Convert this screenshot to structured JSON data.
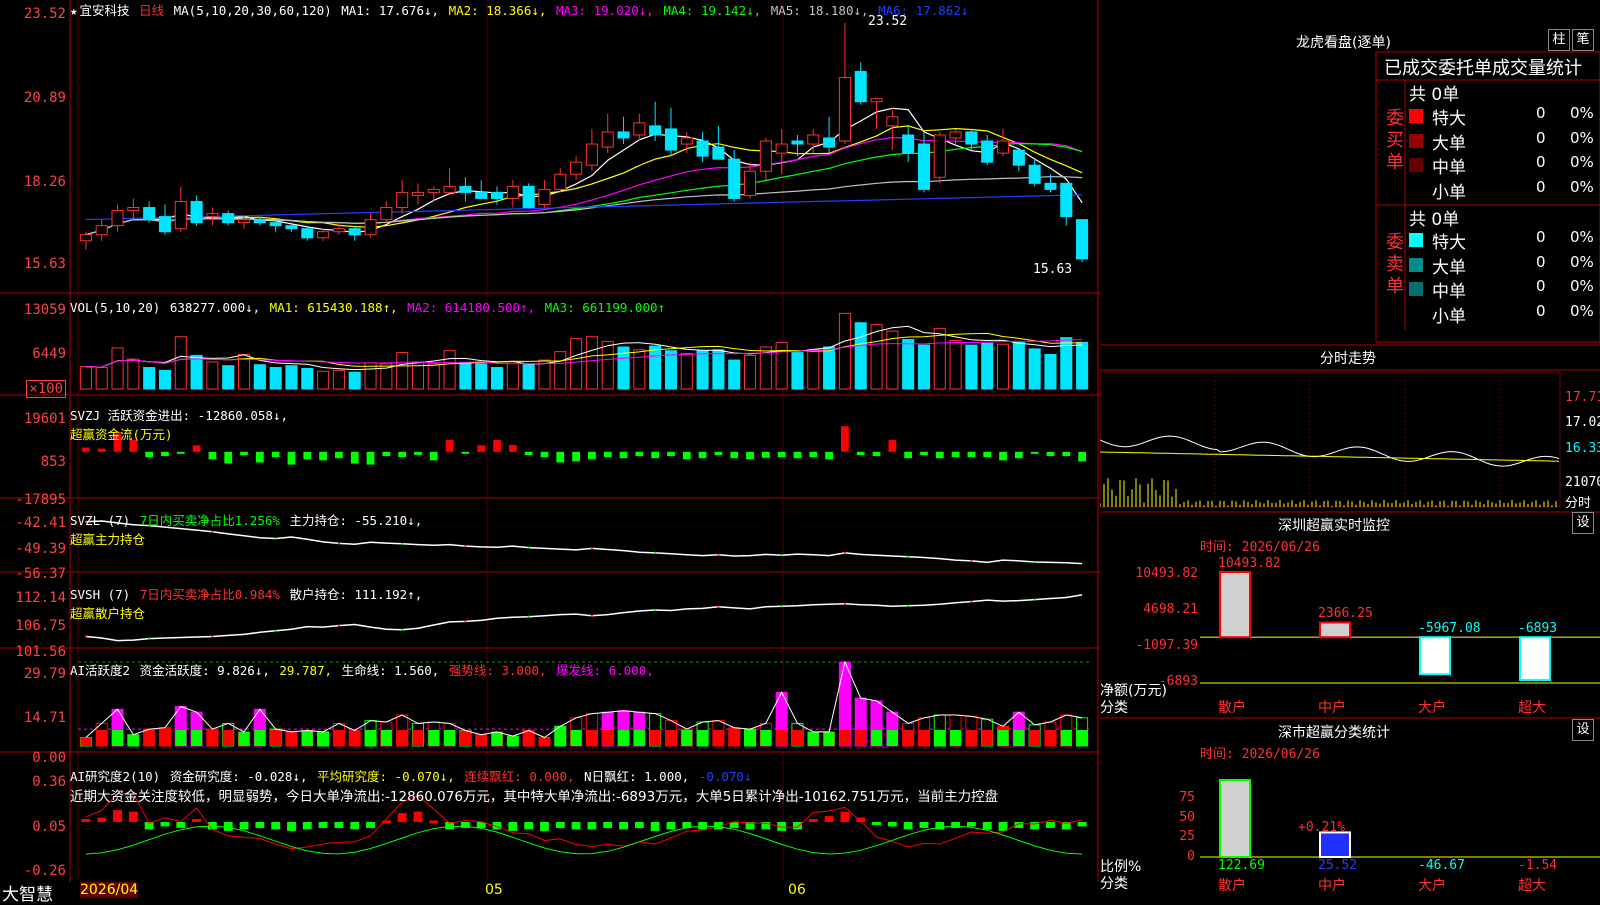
{
  "stock": {
    "name": "宜安科技",
    "period": "日线",
    "ma_label": "MA(5,10,20,30,60,120)",
    "ma1": "MA1: 17.676↓,",
    "ma2": "MA2: 18.366↓,",
    "ma3": "MA3: 19.020↓,",
    "ma4": "MA4: 19.142↓,",
    "ma5": "MA5: 18.180↓,",
    "ma6": "MA6: 17.862↓",
    "high_mark": "23.52",
    "low_mark": "15.63",
    "colors": {
      "ma1": "#ffffff",
      "ma2": "#ffff00",
      "ma3": "#ff00ff",
      "ma4": "#00ff00",
      "ma5": "#c0c0c0",
      "ma6": "#2040ff",
      "up": "#ff3030",
      "down": "#00e5ff"
    }
  },
  "axes": {
    "price": [
      "23.52",
      "20.89",
      "18.26",
      "15.63"
    ],
    "vol": [
      "13059",
      "6449",
      "×100"
    ],
    "svzj": [
      "19601",
      "853",
      "-17895"
    ],
    "svzl": [
      "-42.41",
      "-49.39",
      "-56.37"
    ],
    "svsh": [
      "112.14",
      "106.75",
      "101.56"
    ],
    "ai1": [
      "29.79",
      "14.71",
      "0.00"
    ],
    "ai2": [
      "0.36",
      "0.05",
      "-0.26"
    ]
  },
  "legends": {
    "vol": {
      "a": "VOL(5,10,20)",
      "b": " 638277.000↓,",
      "c": " MA1: 615430.188↑,",
      "d": " MA2: 614180.500↑,",
      "e": " MA3: 661199.000↑"
    },
    "svzj": {
      "a": "SVZJ  活跃资金进出: -12860.058↓,",
      "b": "超赢资金流(万元)"
    },
    "svzl": {
      "a": "SVZL (7) ",
      "b": "7日内买卖净占比1.256%",
      "c": " 主力持仓: -55.210↓,",
      "d": "超赢主力持仓"
    },
    "svsh": {
      "a": "SVSH (7) ",
      "b": "7日内买卖净占比0.984%",
      "c": " 散户持仓: 111.192↑,",
      "d": "超赢散户持仓"
    },
    "ai1": {
      "a": "AI活跃度2 ",
      "b": "资金活跃度: 9.826↓,",
      "c": " 29.787,",
      "d": " 生命线: 1.560,",
      "e": " 强势线: 3.000,",
      "f": " 爆发线: 6.000,"
    },
    "ai2": {
      "a": "AI研究度2(10) ",
      "b": "资金研究度: -0.028↓,",
      "c": " 平均研究度: -0.070↓,",
      "d": " 连续飘红: 0.000,",
      "e": " N日飘红: 1.000,",
      "f": " -0.070↓"
    },
    "ai2_text": "近期大资金关注度较低，明显弱势，今日大单净流出:-12860.076万元，其中特大单净流出:-6893万元，大单5日累计净出-10162.751万元，当前主力控盘"
  },
  "dates": {
    "d1": "2026/04",
    "d2": "05",
    "d3": "06"
  },
  "brand": "大智慧",
  "right": {
    "lhb_title": "龙虎看盘(逐单)",
    "btn1": "柱",
    "btn2": "笔",
    "header": "已成交委托单成交量统计",
    "buy_side": "委买单",
    "sell_side": "委卖单",
    "buy_total": "共 0单",
    "sell_total": "共 0单",
    "buy_rows": [
      {
        "label": "特大",
        "count": "0",
        "pct": "0%",
        "color": "#ff0000"
      },
      {
        "label": "大单",
        "count": "0",
        "pct": "0%",
        "color": "#990000"
      },
      {
        "label": "中单",
        "count": "0",
        "pct": "0%",
        "color": "#660000"
      },
      {
        "label": "小单",
        "count": "0",
        "pct": "0%",
        "color": ""
      }
    ],
    "sell_rows": [
      {
        "label": "特大",
        "count": "0",
        "pct": "0%",
        "color": "#00ffff"
      },
      {
        "label": "大单",
        "count": "0",
        "pct": "0%",
        "color": "#008b8b"
      },
      {
        "label": "中单",
        "count": "0",
        "pct": "0%",
        "color": "#007070"
      },
      {
        "label": "小单",
        "count": "0",
        "pct": "0%",
        "color": ""
      }
    ],
    "intraday_title": "分时走势",
    "intraday_axis": [
      "17.71",
      "17.02",
      "16.33",
      "21070",
      "分时"
    ],
    "monitor_title": "深圳超赢实时监控",
    "monitor_btn": "设",
    "monitor_time": "时间: 2026/06/26",
    "monitor_axis": [
      "10493.82",
      "4698.21",
      "-1097.39",
      "-6893"
    ],
    "monitor_unit": "净额(万元)",
    "monitor_cat_label": "分类",
    "monitor_values": [
      "10493.82",
      "2366.25",
      "-5967.08",
      "-6893"
    ],
    "categories": [
      "散户",
      "中户",
      "大户",
      "超大"
    ],
    "stats_title": "深市超赢分类统计",
    "stats_btn": "设",
    "stats_time": "时间: 2026/06/26",
    "stats_axis": [
      "75",
      "50",
      "25",
      "0"
    ],
    "stats_unit": "比例%",
    "stats_cat_label": "分类",
    "stats_top_label": "+0.21%",
    "stats_values": [
      "122.69",
      "25.52",
      "-46.67",
      "-1.54"
    ]
  },
  "chart_data": {
    "type": "candlestick",
    "title": "宜安科技 日线",
    "candles": [
      {
        "o": 16.3,
        "h": 16.6,
        "l": 16.0,
        "c": 16.5
      },
      {
        "o": 16.5,
        "h": 17.0,
        "l": 16.3,
        "c": 16.8
      },
      {
        "o": 16.8,
        "h": 17.5,
        "l": 16.6,
        "c": 17.3
      },
      {
        "o": 17.3,
        "h": 17.7,
        "l": 17.0,
        "c": 17.4
      },
      {
        "o": 17.4,
        "h": 17.6,
        "l": 16.9,
        "c": 17.0
      },
      {
        "o": 17.1,
        "h": 17.5,
        "l": 16.5,
        "c": 16.6
      },
      {
        "o": 16.7,
        "h": 18.1,
        "l": 16.6,
        "c": 17.6
      },
      {
        "o": 17.6,
        "h": 17.8,
        "l": 16.8,
        "c": 16.9
      },
      {
        "o": 17.1,
        "h": 17.4,
        "l": 16.8,
        "c": 17.2
      },
      {
        "o": 17.2,
        "h": 17.3,
        "l": 16.8,
        "c": 16.9
      },
      {
        "o": 16.9,
        "h": 17.1,
        "l": 16.7,
        "c": 17.0
      },
      {
        "o": 17.0,
        "h": 17.1,
        "l": 16.8,
        "c": 16.9
      },
      {
        "o": 16.9,
        "h": 17.0,
        "l": 16.6,
        "c": 16.8
      },
      {
        "o": 16.8,
        "h": 16.9,
        "l": 16.6,
        "c": 16.7
      },
      {
        "o": 16.7,
        "h": 16.8,
        "l": 16.3,
        "c": 16.4
      },
      {
        "o": 16.4,
        "h": 16.7,
        "l": 16.3,
        "c": 16.6
      },
      {
        "o": 16.6,
        "h": 16.9,
        "l": 16.5,
        "c": 16.7
      },
      {
        "o": 16.7,
        "h": 16.8,
        "l": 16.3,
        "c": 16.5
      },
      {
        "o": 16.5,
        "h": 17.2,
        "l": 16.4,
        "c": 17.0
      },
      {
        "o": 17.0,
        "h": 17.6,
        "l": 16.9,
        "c": 17.4
      },
      {
        "o": 17.4,
        "h": 18.3,
        "l": 17.2,
        "c": 17.9
      },
      {
        "o": 17.8,
        "h": 18.2,
        "l": 17.5,
        "c": 17.9
      },
      {
        "o": 17.9,
        "h": 18.1,
        "l": 17.6,
        "c": 18.0
      },
      {
        "o": 17.9,
        "h": 18.7,
        "l": 17.8,
        "c": 18.1
      },
      {
        "o": 18.1,
        "h": 18.4,
        "l": 17.6,
        "c": 17.9
      },
      {
        "o": 17.9,
        "h": 18.3,
        "l": 17.7,
        "c": 17.7
      },
      {
        "o": 17.9,
        "h": 18.1,
        "l": 17.5,
        "c": 17.7
      },
      {
        "o": 17.7,
        "h": 18.3,
        "l": 17.4,
        "c": 18.1
      },
      {
        "o": 18.1,
        "h": 18.2,
        "l": 17.4,
        "c": 17.4
      },
      {
        "o": 17.5,
        "h": 18.3,
        "l": 17.4,
        "c": 18.0
      },
      {
        "o": 18.0,
        "h": 18.7,
        "l": 17.9,
        "c": 18.5
      },
      {
        "o": 18.5,
        "h": 19.1,
        "l": 18.3,
        "c": 18.9
      },
      {
        "o": 18.8,
        "h": 20.0,
        "l": 18.6,
        "c": 19.5
      },
      {
        "o": 19.4,
        "h": 20.5,
        "l": 19.2,
        "c": 19.9
      },
      {
        "o": 19.9,
        "h": 20.4,
        "l": 19.5,
        "c": 19.7
      },
      {
        "o": 19.8,
        "h": 20.5,
        "l": 19.6,
        "c": 20.2
      },
      {
        "o": 20.1,
        "h": 20.9,
        "l": 19.6,
        "c": 19.8
      },
      {
        "o": 20.0,
        "h": 20.7,
        "l": 19.1,
        "c": 19.3
      },
      {
        "o": 19.5,
        "h": 19.9,
        "l": 19.2,
        "c": 19.7
      },
      {
        "o": 19.6,
        "h": 19.9,
        "l": 18.9,
        "c": 19.1
      },
      {
        "o": 19.4,
        "h": 20.1,
        "l": 19.2,
        "c": 19.0
      },
      {
        "o": 19.0,
        "h": 19.3,
        "l": 17.6,
        "c": 17.7
      },
      {
        "o": 17.8,
        "h": 18.9,
        "l": 17.7,
        "c": 18.6
      },
      {
        "o": 18.6,
        "h": 19.7,
        "l": 18.3,
        "c": 19.6
      },
      {
        "o": 19.2,
        "h": 20.0,
        "l": 18.5,
        "c": 19.5
      },
      {
        "o": 19.6,
        "h": 19.8,
        "l": 19.1,
        "c": 19.5
      },
      {
        "o": 19.5,
        "h": 20.0,
        "l": 19.2,
        "c": 19.8
      },
      {
        "o": 19.7,
        "h": 20.4,
        "l": 19.2,
        "c": 19.4
      },
      {
        "o": 19.6,
        "h": 23.5,
        "l": 19.5,
        "c": 21.7
      },
      {
        "o": 21.9,
        "h": 22.2,
        "l": 20.8,
        "c": 20.9
      },
      {
        "o": 20.9,
        "h": 21.0,
        "l": 20.0,
        "c": 21.0
      },
      {
        "o": 20.1,
        "h": 20.7,
        "l": 19.3,
        "c": 20.4
      },
      {
        "o": 19.8,
        "h": 20.1,
        "l": 18.9,
        "c": 19.2
      },
      {
        "o": 19.5,
        "h": 19.9,
        "l": 17.9,
        "c": 18.0
      },
      {
        "o": 18.4,
        "h": 19.9,
        "l": 18.2,
        "c": 19.8
      },
      {
        "o": 19.7,
        "h": 20.0,
        "l": 19.5,
        "c": 19.9
      },
      {
        "o": 19.9,
        "h": 20.0,
        "l": 19.3,
        "c": 19.5
      },
      {
        "o": 19.6,
        "h": 19.8,
        "l": 18.8,
        "c": 18.9
      },
      {
        "o": 19.2,
        "h": 20.0,
        "l": 19.1,
        "c": 19.6
      },
      {
        "o": 19.3,
        "h": 19.3,
        "l": 18.6,
        "c": 18.8
      },
      {
        "o": 18.8,
        "h": 19.0,
        "l": 18.1,
        "c": 18.2
      },
      {
        "o": 18.2,
        "h": 18.5,
        "l": 17.9,
        "c": 18.0
      },
      {
        "o": 18.2,
        "h": 18.2,
        "l": 16.8,
        "c": 17.1
      },
      {
        "o": 17.0,
        "h": 17.0,
        "l": 15.6,
        "c": 15.7
      }
    ],
    "volume": [
      2400,
      2300,
      4400,
      3200,
      2300,
      2000,
      5600,
      3600,
      2900,
      2500,
      3700,
      2600,
      2300,
      2500,
      2200,
      1900,
      2000,
      1800,
      2800,
      2700,
      3900,
      2900,
      2700,
      4100,
      2800,
      2700,
      2300,
      2900,
      2600,
      3100,
      4000,
      5400,
      5600,
      5100,
      4500,
      4200,
      4600,
      4100,
      3800,
      4100,
      4200,
      3100,
      3600,
      4500,
      5000,
      3900,
      4200,
      4500,
      8100,
      7100,
      6900,
      6200,
      5300,
      4700,
      6500,
      5200,
      4700,
      4900,
      4800,
      5000,
      4300,
      3700,
      5500,
      5000
    ],
    "svzj": [
      2000,
      1500,
      8500,
      5500,
      -2500,
      -2000,
      -500,
      3000,
      -3500,
      -5500,
      -1500,
      -5000,
      -2500,
      -6000,
      -3500,
      -4000,
      -3000,
      -5500,
      -6000,
      -2000,
      -2500,
      -1500,
      -4000,
      5500,
      -500,
      3000,
      5500,
      3200,
      -1500,
      -2500,
      -5000,
      -4500,
      -3500,
      -2500,
      -3000,
      -2000,
      -3000,
      -2000,
      -3500,
      -3000,
      -1500,
      -3000,
      -3500,
      -2800,
      -2500,
      -3000,
      -2500,
      -3500,
      12000,
      -1500,
      -2000,
      5500,
      -3000,
      -1500,
      -3000,
      -2500,
      -2500,
      -2500,
      -4000,
      -3000,
      -500,
      -2000,
      -2000,
      -4500
    ],
    "svzl": [
      -44.2,
      -44.0,
      -44.5,
      -45.0,
      -45.2,
      -45.6,
      -46.0,
      -46.4,
      -46.8,
      -47.4,
      -47.9,
      -48.4,
      -48.6,
      -48.2,
      -48.8,
      -49.5,
      -49.9,
      -50.1,
      -49.6,
      -49.8,
      -50.0,
      -50.2,
      -50.4,
      -50.2,
      -50.6,
      -50.8,
      -50.9,
      -50.6,
      -51.0,
      -51.2,
      -51.4,
      -51.6,
      -51.2,
      -51.5,
      -51.8,
      -52.2,
      -52.4,
      -52.6,
      -52.9,
      -53.1,
      -52.9,
      -53.2,
      -53.1,
      -52.8,
      -53.0,
      -52.7,
      -52.9,
      -53.1,
      -52.4,
      -52.8,
      -53.0,
      -53.2,
      -53.4,
      -53.6,
      -53.9,
      -54.3,
      -54.5,
      -54.9,
      -54.3,
      -54.5,
      -54.8,
      -54.9,
      -55.0,
      -55.2
    ],
    "svsh": [
      103.2,
      102.9,
      102.4,
      102.5,
      102.8,
      102.9,
      103.0,
      103.1,
      103.2,
      103.4,
      103.6,
      104.0,
      104.3,
      104.6,
      105.1,
      105.0,
      105.3,
      105.5,
      105.0,
      104.6,
      104.5,
      104.8,
      105.4,
      106.0,
      106.1,
      106.3,
      106.7,
      106.9,
      107.0,
      107.2,
      107.4,
      107.5,
      107.2,
      107.4,
      107.8,
      108.1,
      108.3,
      108.2,
      108.5,
      108.6,
      108.9,
      108.7,
      108.5,
      108.9,
      109.0,
      109.1,
      109.3,
      109.4,
      109.5,
      109.3,
      109.2,
      109.0,
      109.1,
      109.2,
      109.4,
      109.7,
      109.9,
      110.2,
      110.0,
      110.1,
      110.3,
      110.5,
      110.7,
      111.2
    ],
    "ai1": [
      3.0,
      8.0,
      13.0,
      4.0,
      6.0,
      6.5,
      14.0,
      12.0,
      6.0,
      8.0,
      5.0,
      13.0,
      6.0,
      5.0,
      5.5,
      5.0,
      8.0,
      5.5,
      9.0,
      8.5,
      11.0,
      8.0,
      8.5,
      8.0,
      5.5,
      4.0,
      5.0,
      3.5,
      5.5,
      3.0,
      7.0,
      10.0,
      11.5,
      12.0,
      12.5,
      12.0,
      11.5,
      9.0,
      6.0,
      8.5,
      9.0,
      6.5,
      6.0,
      8.0,
      19.0,
      8.0,
      5.0,
      5.0,
      29.8,
      17.0,
      16.0,
      12.0,
      8.0,
      10.0,
      11.0,
      11.0,
      10.5,
      9.5,
      7.0,
      12.0,
      7.5,
      8.5,
      11.0,
      10.0
    ],
    "ai2": [
      0.02,
      0.03,
      0.08,
      0.07,
      -0.05,
      -0.03,
      -0.04,
      0.02,
      -0.05,
      -0.06,
      -0.05,
      -0.04,
      -0.05,
      -0.06,
      -0.05,
      -0.04,
      -0.04,
      -0.05,
      -0.04,
      0.01,
      0.06,
      0.07,
      0.01,
      -0.05,
      -0.04,
      -0.04,
      -0.05,
      -0.06,
      -0.05,
      -0.06,
      -0.04,
      -0.05,
      -0.05,
      -0.04,
      -0.05,
      -0.04,
      -0.06,
      -0.05,
      -0.04,
      -0.05,
      -0.05,
      -0.04,
      -0.05,
      -0.05,
      -0.06,
      -0.05,
      0.02,
      0.04,
      0.07,
      0.03,
      -0.02,
      -0.03,
      -0.05,
      -0.04,
      -0.05,
      -0.04,
      -0.03,
      -0.05,
      -0.06,
      -0.04,
      -0.05,
      -0.04,
      -0.05,
      -0.03
    ],
    "price_range": [
      15.4,
      23.8
    ],
    "series": [
      {
        "name": "MA1"
      },
      {
        "name": "MA2"
      },
      {
        "name": "MA3"
      },
      {
        "name": "MA4"
      },
      {
        "name": "MA5"
      },
      {
        "name": "MA6"
      }
    ]
  }
}
